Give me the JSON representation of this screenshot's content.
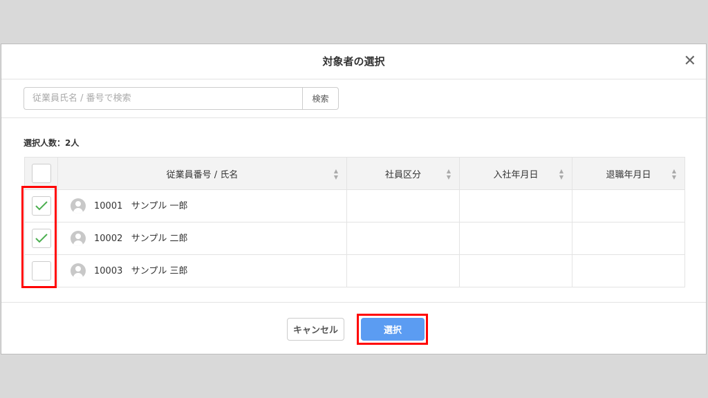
{
  "dialog": {
    "title": "対象者の選択",
    "close_icon": "close-icon"
  },
  "search": {
    "placeholder": "従業員氏名 / 番号で検索",
    "value": "",
    "button": "検索"
  },
  "selected_count": "選択人数：2人",
  "table": {
    "headers": [
      "従業員番号 / 氏名",
      "社員区分",
      "入社年月日",
      "退職年月日"
    ],
    "rows": [
      {
        "id": "10001",
        "name": "サンプル 一郎",
        "checked": true
      },
      {
        "id": "10002",
        "name": "サンプル 二郎",
        "checked": true
      },
      {
        "id": "10003",
        "name": "サンプル 三郎",
        "checked": false
      }
    ]
  },
  "footer": {
    "cancel": "キャンセル",
    "select": "選択"
  },
  "colors": {
    "accent": "#5b9cf2",
    "check": "#4caf50",
    "highlight": "#ff0000"
  }
}
